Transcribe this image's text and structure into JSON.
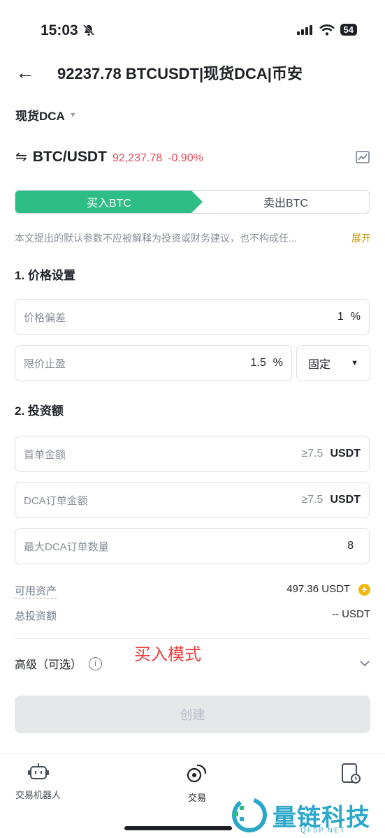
{
  "status": {
    "time": "15:03",
    "battery": "54"
  },
  "header": {
    "title": "92237.78 BTCUSDT|现货DCA|币安"
  },
  "mode": {
    "label": "现货DCA"
  },
  "pair": {
    "symbol": "BTC/USDT",
    "price": "92,237.78",
    "change": "-0.90%"
  },
  "tabs": {
    "buy": "买入BTC",
    "sell": "卖出BTC"
  },
  "disclaimer": {
    "text": "本文提出的默认参数不应被解释为投资或财务建议，也不构成任...",
    "more": "展开"
  },
  "price_settings": {
    "title": "1. 价格设置",
    "deviation": {
      "placeholder": "价格偏差",
      "value": "1",
      "unit": "%"
    },
    "take_profit": {
      "placeholder": "限价止盈",
      "value": "1.5",
      "unit": "%",
      "mode": "固定"
    }
  },
  "investment": {
    "title": "2. 投资额",
    "first_order": {
      "placeholder": "首单金额",
      "hint": "≥7.5",
      "unit": "USDT"
    },
    "dca_order": {
      "placeholder": "DCA订单金额",
      "hint": "≥7.5",
      "unit": "USDT"
    },
    "max_orders": {
      "placeholder": "最大DCA订单数量",
      "value": "8"
    }
  },
  "balances": {
    "available_label": "可用资产",
    "available_value": "497.36 USDT",
    "total_label": "总投资额",
    "total_value": "-- USDT"
  },
  "advanced": {
    "label": "高级（可选）",
    "info": "i"
  },
  "annotation": "买入模式",
  "create_button": "创建",
  "bottom_nav": [
    {
      "label": "交易机器人"
    },
    {
      "label": "交易"
    }
  ],
  "watermark": {
    "text": "量链科技",
    "sub": "QFSP.NET"
  },
  "colors": {
    "green": "#2ebd85",
    "red": "#e04a59",
    "yellow": "#f0b90b",
    "annotation": "#e8403f"
  }
}
